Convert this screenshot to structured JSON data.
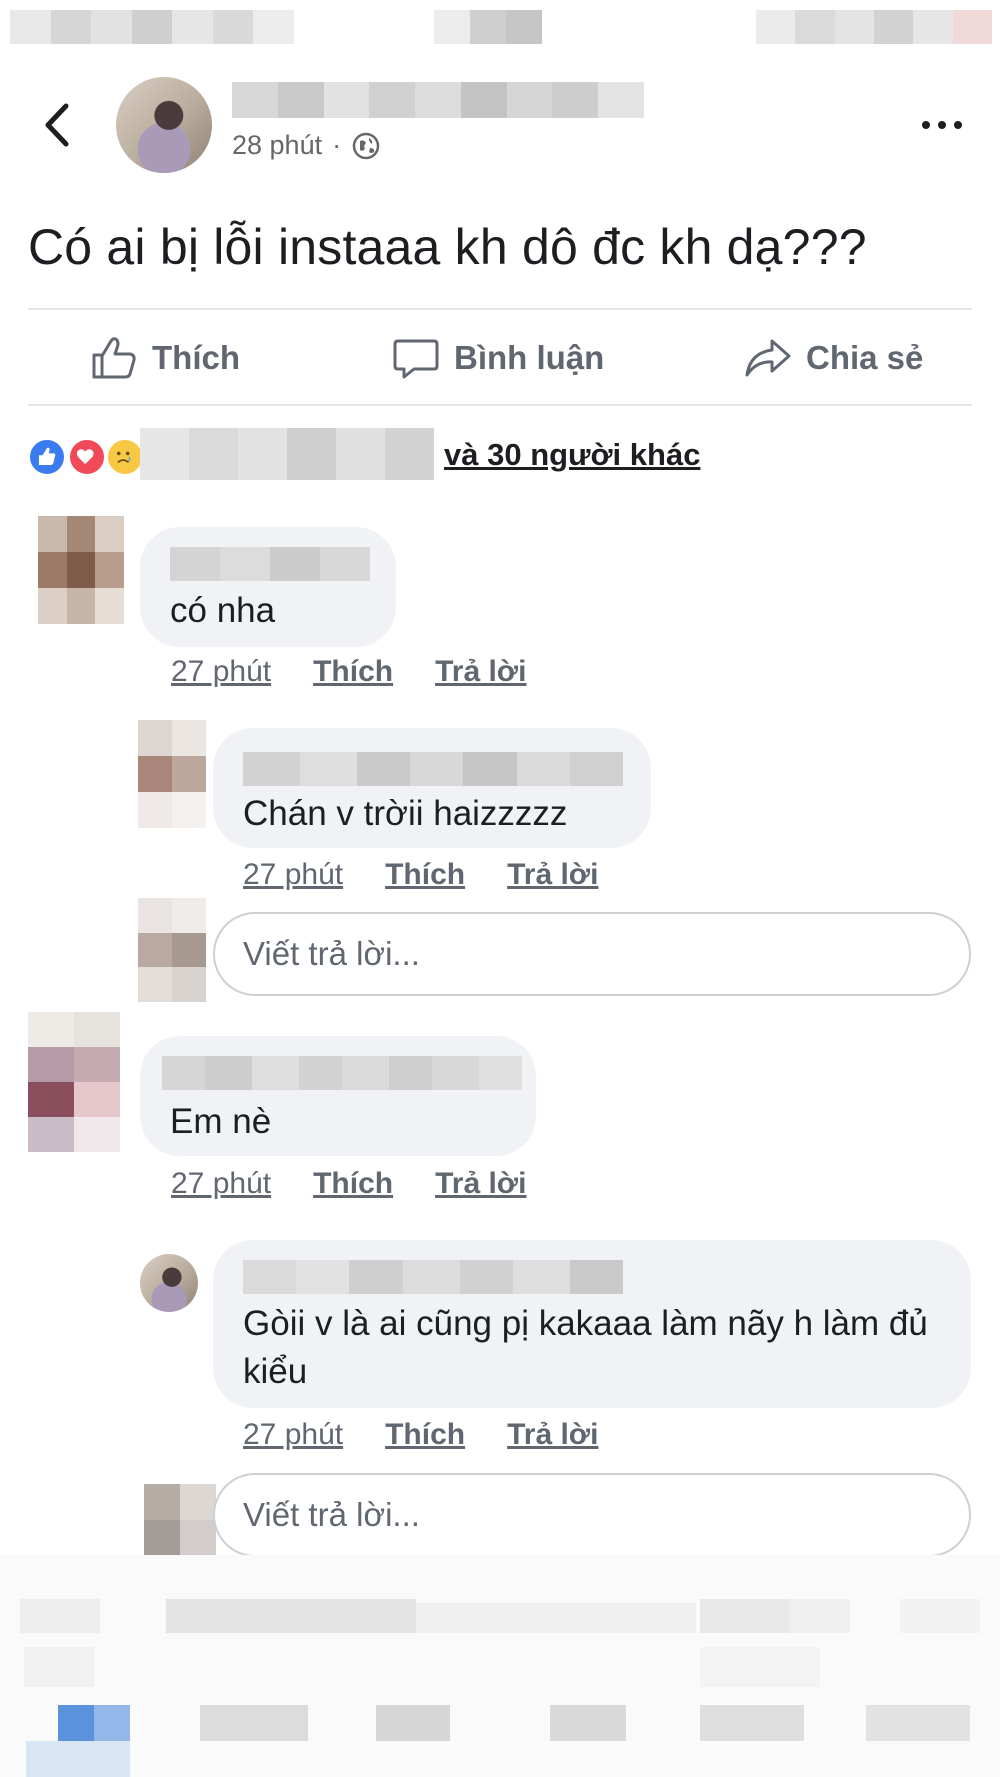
{
  "post": {
    "time": "28 phút",
    "separator": "·",
    "text": "Có ai bị lỗi instaaa kh dô đc kh dạ???"
  },
  "actions": {
    "like": "Thích",
    "comment": "Bình luận",
    "share": "Chia sẻ"
  },
  "reactions": {
    "types": [
      "like",
      "love",
      "sad"
    ],
    "summary": "và 30 người khác"
  },
  "comments": [
    {
      "text": "có nha",
      "time": "27 phút",
      "like": "Thích",
      "reply": "Trả lời",
      "replies": [
        {
          "text": "Chán v trờii haizzzzz",
          "time": "27 phút",
          "like": "Thích",
          "reply": "Trả lời"
        }
      ],
      "reply_placeholder": "Viết trả lời..."
    },
    {
      "text": "Em nè",
      "time": "27 phút",
      "like": "Thích",
      "reply": "Trả lời",
      "replies": [
        {
          "text": "Gòii v là ai cũng pị kakaaa làm nãy h làm đủ kiểu",
          "time": "27 phút",
          "like": "Thích",
          "reply": "Trả lời"
        }
      ],
      "reply_placeholder": "Viết trả lời..."
    }
  ],
  "colors": {
    "accent": "#1877f2",
    "muted_text": "#606770",
    "bubble": "#f0f2f5",
    "like": "#3b7bf0",
    "love": "#f04a5a",
    "sad": "#f6c844"
  }
}
